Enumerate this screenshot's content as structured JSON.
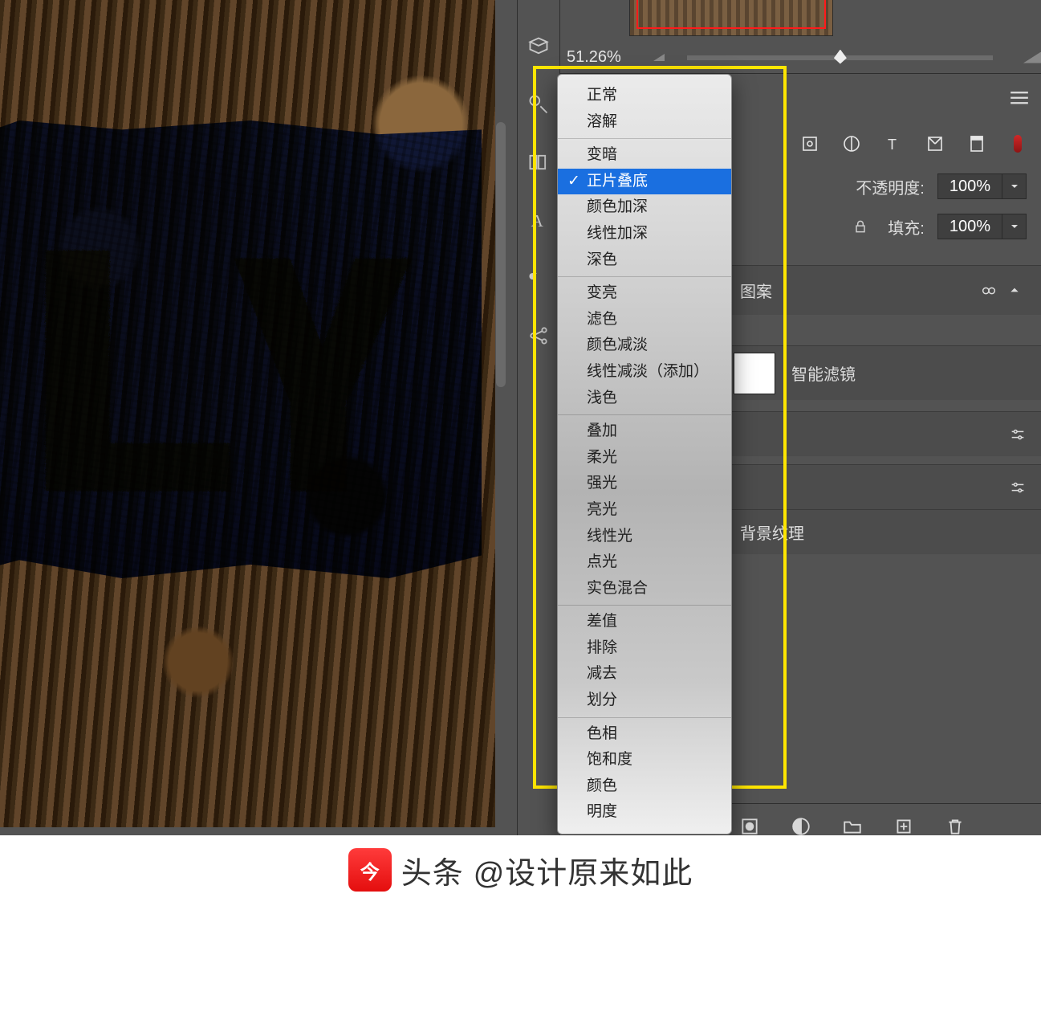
{
  "canvas": {
    "text": "LY"
  },
  "navigator": {
    "zoom_percent": "51.26%"
  },
  "layers_panel": {
    "opacity_label": "不透明度:",
    "opacity_value": "100%",
    "fill_label": "填充:",
    "fill_value": "100%",
    "rows": {
      "pattern": "图案",
      "smart_filters": "智能滤镜",
      "bg_texture": "背景纹理"
    }
  },
  "blend_modes": {
    "groups": [
      [
        "正常",
        "溶解"
      ],
      [
        "变暗",
        "正片叠底",
        "颜色加深",
        "线性加深",
        "深色"
      ],
      [
        "变亮",
        "滤色",
        "颜色减淡",
        "线性减淡（添加）",
        "浅色"
      ],
      [
        "叠加",
        "柔光",
        "强光",
        "亮光",
        "线性光",
        "点光",
        "实色混合"
      ],
      [
        "差值",
        "排除",
        "减去",
        "划分"
      ],
      [
        "色相",
        "饱和度",
        "颜色",
        "明度"
      ]
    ],
    "selected": "正片叠底"
  },
  "watermark": {
    "brand": "头条",
    "handle": "@设计原来如此"
  },
  "colors": {
    "highlight": "#ffe600",
    "selected_bg": "#1a6fe0"
  }
}
